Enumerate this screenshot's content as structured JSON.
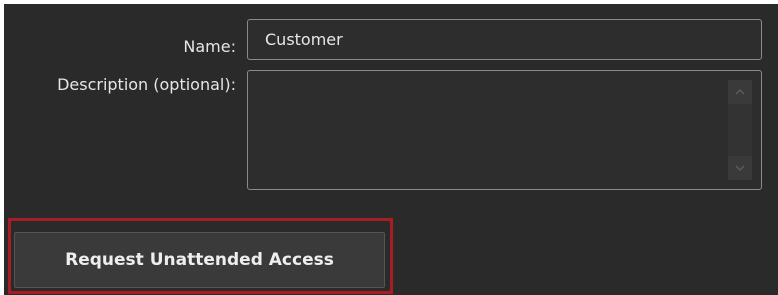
{
  "form": {
    "name_label": "Name:",
    "name_value": "Customer",
    "description_label": "Description (optional):",
    "description_value": ""
  },
  "actions": {
    "request_button_label": "Request Unattended Access"
  },
  "icons": {
    "scroll_up": "chevron-up-icon",
    "scroll_down": "chevron-down-icon"
  },
  "colors": {
    "background": "#2a2a2a",
    "field_border": "#8a8a8a",
    "highlight": "#a61d24",
    "text": "#e6e6e6"
  }
}
